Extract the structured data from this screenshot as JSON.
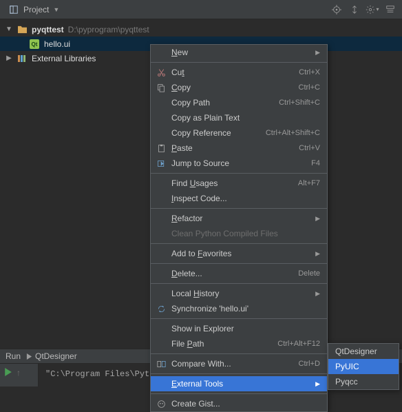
{
  "toolbar": {
    "project_label": "Project"
  },
  "tree": {
    "root": {
      "name": "pyqttest",
      "path": "D:\\pyprogram\\pyqttest"
    },
    "file": {
      "name": "hello.ui"
    },
    "libs": {
      "name": "External Libraries"
    }
  },
  "runbar": {
    "run": "Run",
    "config": "QtDesigner"
  },
  "console": {
    "path": "\"C:\\Program Files\\Python"
  },
  "menu": {
    "new": "New",
    "cut": {
      "label": "Cut",
      "key": "t",
      "shortcut": "Ctrl+X"
    },
    "copy": {
      "label": "Copy",
      "key": "C",
      "shortcut": "Ctrl+C"
    },
    "copypath": {
      "label": "Copy Path",
      "shortcut": "Ctrl+Shift+C"
    },
    "copyplain": {
      "label": "Copy as Plain Text"
    },
    "copyref": {
      "label": "Copy Reference",
      "shortcut": "Ctrl+Alt+Shift+C"
    },
    "paste": {
      "label": "Paste",
      "key": "P",
      "shortcut": "Ctrl+V"
    },
    "jump": {
      "label": "Jump to Source",
      "shortcut": "F4"
    },
    "usages": {
      "label": "Find Usages",
      "key": "U",
      "shortcut": "Alt+F7"
    },
    "inspect": {
      "label": "Inspect Code...",
      "key": "I"
    },
    "refactor": {
      "label": "Refactor",
      "key": "R"
    },
    "clean": {
      "label": "Clean Python Compiled Files"
    },
    "fav": {
      "label": "Add to Favorites",
      "key": "F"
    },
    "delete": {
      "label": "Delete...",
      "key": "D",
      "shortcut": "Delete"
    },
    "localhist": {
      "label": "Local History",
      "key": "H"
    },
    "sync": {
      "label": "Synchronize 'hello.ui'"
    },
    "show": {
      "label": "Show in Explorer"
    },
    "filepath": {
      "label": "File Path",
      "key": "P",
      "shortcut": "Ctrl+Alt+F12"
    },
    "compare": {
      "label": "Compare With...",
      "shortcut": "Ctrl+D"
    },
    "external": {
      "label": "External Tools",
      "key": "E"
    },
    "gist": {
      "label": "Create Gist..."
    }
  },
  "submenu": {
    "qtd": "QtDesigner",
    "pyuic": "PyUIC",
    "pyqcc": "Pyqcc"
  }
}
